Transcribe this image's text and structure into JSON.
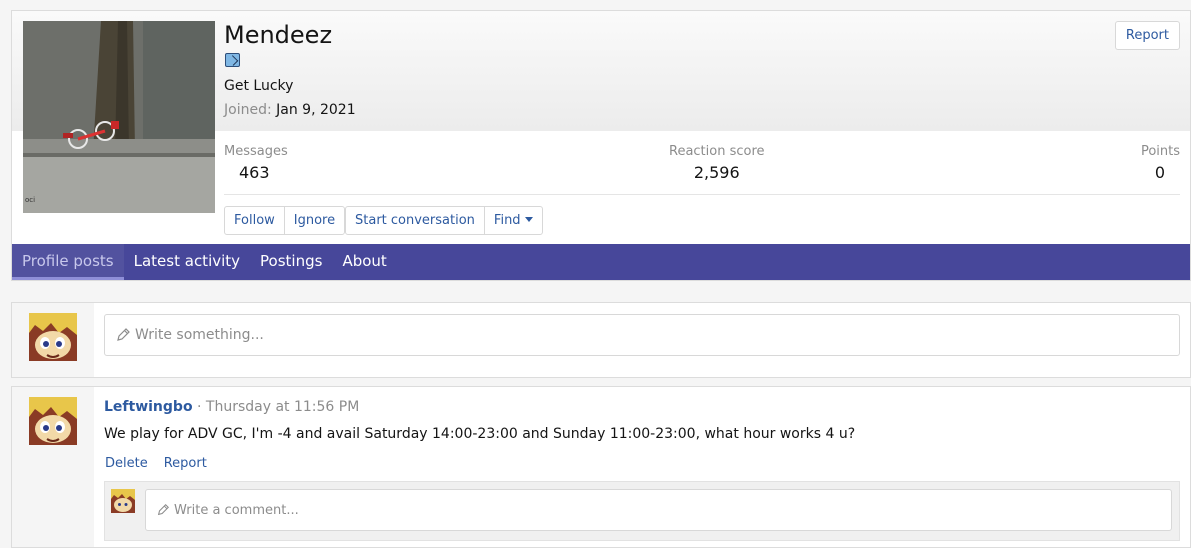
{
  "profile": {
    "username": "Mendeez",
    "user_title": "Get Lucky",
    "joined_label": "Joined:",
    "joined_value": "Jan 9, 2021",
    "report_label": "Report",
    "stats": {
      "messages_label": "Messages",
      "messages_value": "463",
      "reaction_label": "Reaction score",
      "reaction_value": "2,596",
      "points_label": "Points",
      "points_value": "0"
    },
    "buttons": {
      "follow": "Follow",
      "ignore": "Ignore",
      "start_conversation": "Start conversation",
      "find": "Find"
    }
  },
  "tabs": [
    {
      "label": "Profile posts",
      "active": true
    },
    {
      "label": "Latest activity",
      "active": false
    },
    {
      "label": "Postings",
      "active": false
    },
    {
      "label": "About",
      "active": false
    }
  ],
  "composer": {
    "placeholder": "Write something..."
  },
  "post": {
    "author": "Leftwingbo",
    "separator": "·",
    "time": "Thursday at 11:56 PM",
    "body": "We play for ADV GC, I'm -4 and avail Saturday 14:00-23:00 and Sunday 11:00-23:00, what hour works 4 u?",
    "delete_label": "Delete",
    "report_label": "Report",
    "comment_placeholder": "Write a comment..."
  },
  "colors": {
    "tab_bar": "#47479a",
    "link": "#2d5aa0"
  },
  "icons": {
    "badge": "badge-icon",
    "pencil": "pencil-icon",
    "dropdown": "caret-down-icon"
  }
}
